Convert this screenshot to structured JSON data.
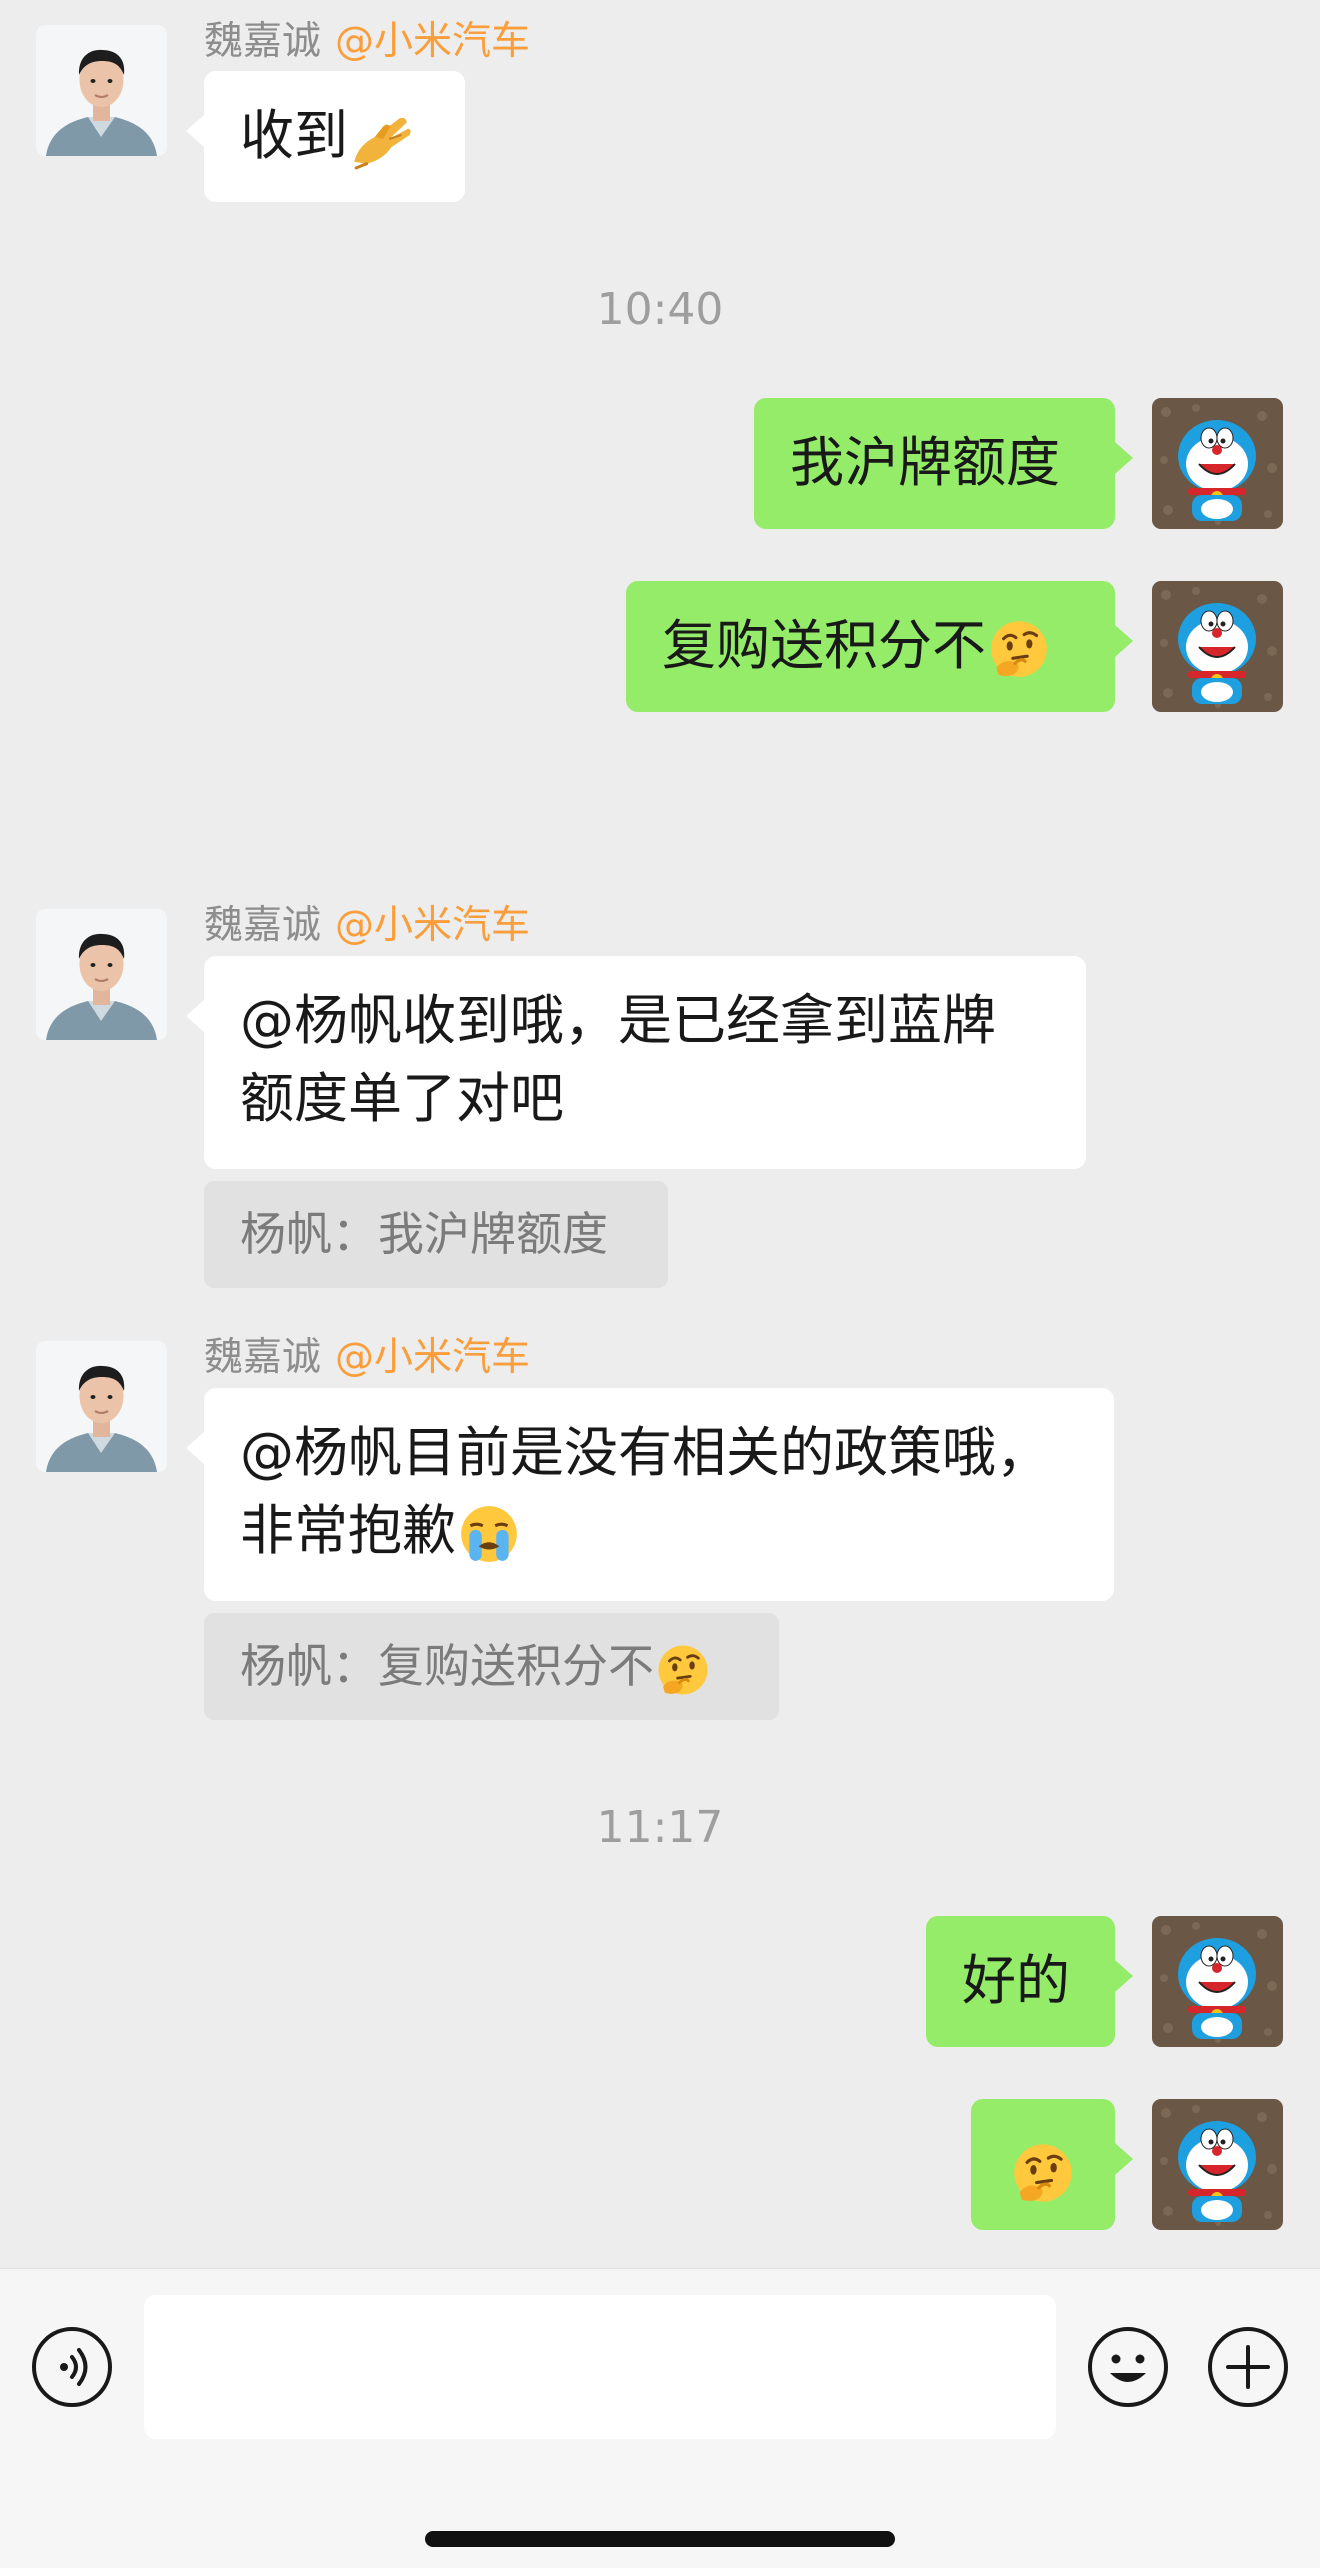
{
  "chat": {
    "messages": [
      {
        "sender_name": "魏嘉诚",
        "sender_group": "@小米汽车",
        "text": "收到",
        "emoji": "pinched-hand-emoji"
      },
      {
        "time": "10:40"
      },
      {
        "text": "我沪牌额度"
      },
      {
        "text": "复购送积分不",
        "emoji": "thinking-face-emoji"
      },
      {
        "sender_name": "魏嘉诚",
        "sender_group": "@小米汽车",
        "text_line1": "@杨帆收到哦，是已经拿到蓝牌",
        "text_line2": "额度单了对吧",
        "quote": "杨帆：我沪牌额度"
      },
      {
        "sender_name": "魏嘉诚",
        "sender_group": "@小米汽车",
        "text_line1": "@杨帆目前是没有相关的政策哦，",
        "text_line2": "非常抱歉",
        "emoji": "crying-face-emoji",
        "quote": "杨帆：复购送积分不",
        "quote_emoji": "thinking-face-emoji"
      },
      {
        "time": "11:17"
      },
      {
        "text": "好的"
      },
      {
        "emoji": "thinking-face-emoji"
      }
    ]
  },
  "input_bar": {
    "voice_icon": "voice-icon",
    "emoji_icon": "smiley-icon",
    "more_icon": "plus-icon",
    "text_value": ""
  },
  "colors": {
    "background": "#ededed",
    "outgoing_bubble": "#95ec69",
    "incoming_bubble": "#ffffff",
    "group_tag": "#fa9d3b",
    "quote_bg": "#e1e1e1"
  }
}
